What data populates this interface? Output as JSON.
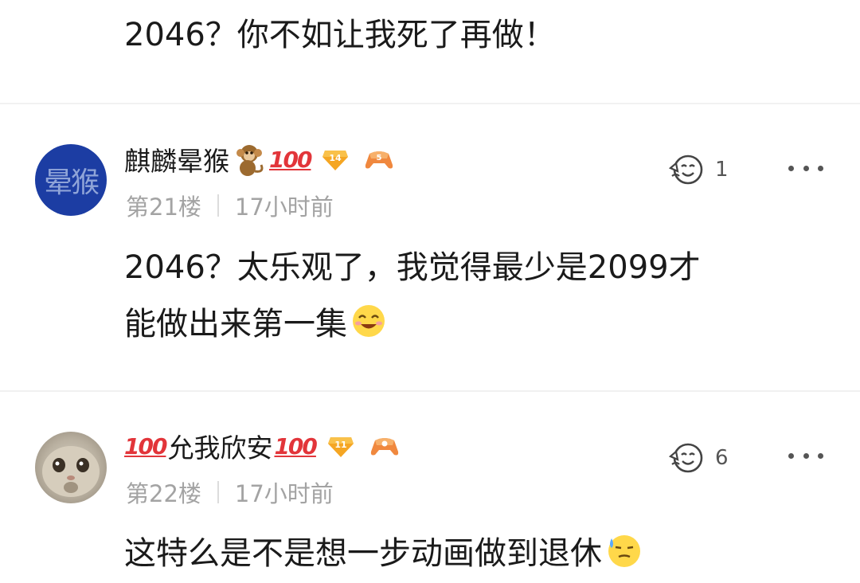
{
  "top_comment": {
    "text": "2046？你不如让我死了再做！"
  },
  "comments": [
    {
      "avatar_text": "晕猴",
      "username": "麒麟晕猴",
      "username_emoji": "monkey-icon",
      "badge_100": "100",
      "level": "14",
      "game_level": "5",
      "floor": "第21楼",
      "time": "17小时前",
      "likes": "1",
      "text_line1": "2046？太乐观了，我觉得最少是2099才",
      "text_line2": "能做出来第一集",
      "text_emoji": "laughing-face-icon"
    },
    {
      "avatar_text": "",
      "username_prefix_badge": "100",
      "username": "允我欣安",
      "badge_100": "100",
      "level": "11",
      "game_level": "",
      "floor": "第22楼",
      "time": "17小时前",
      "likes": "6",
      "text_line1": "这特么是不是想一步动画做到退休",
      "text_emoji": "sweat-face-icon"
    }
  ],
  "colors": {
    "badge_red": "#e2353a",
    "level_gold": "#f5a623",
    "meta_gray": "#a3a3a3",
    "avatar_blue": "#1c3da3"
  }
}
